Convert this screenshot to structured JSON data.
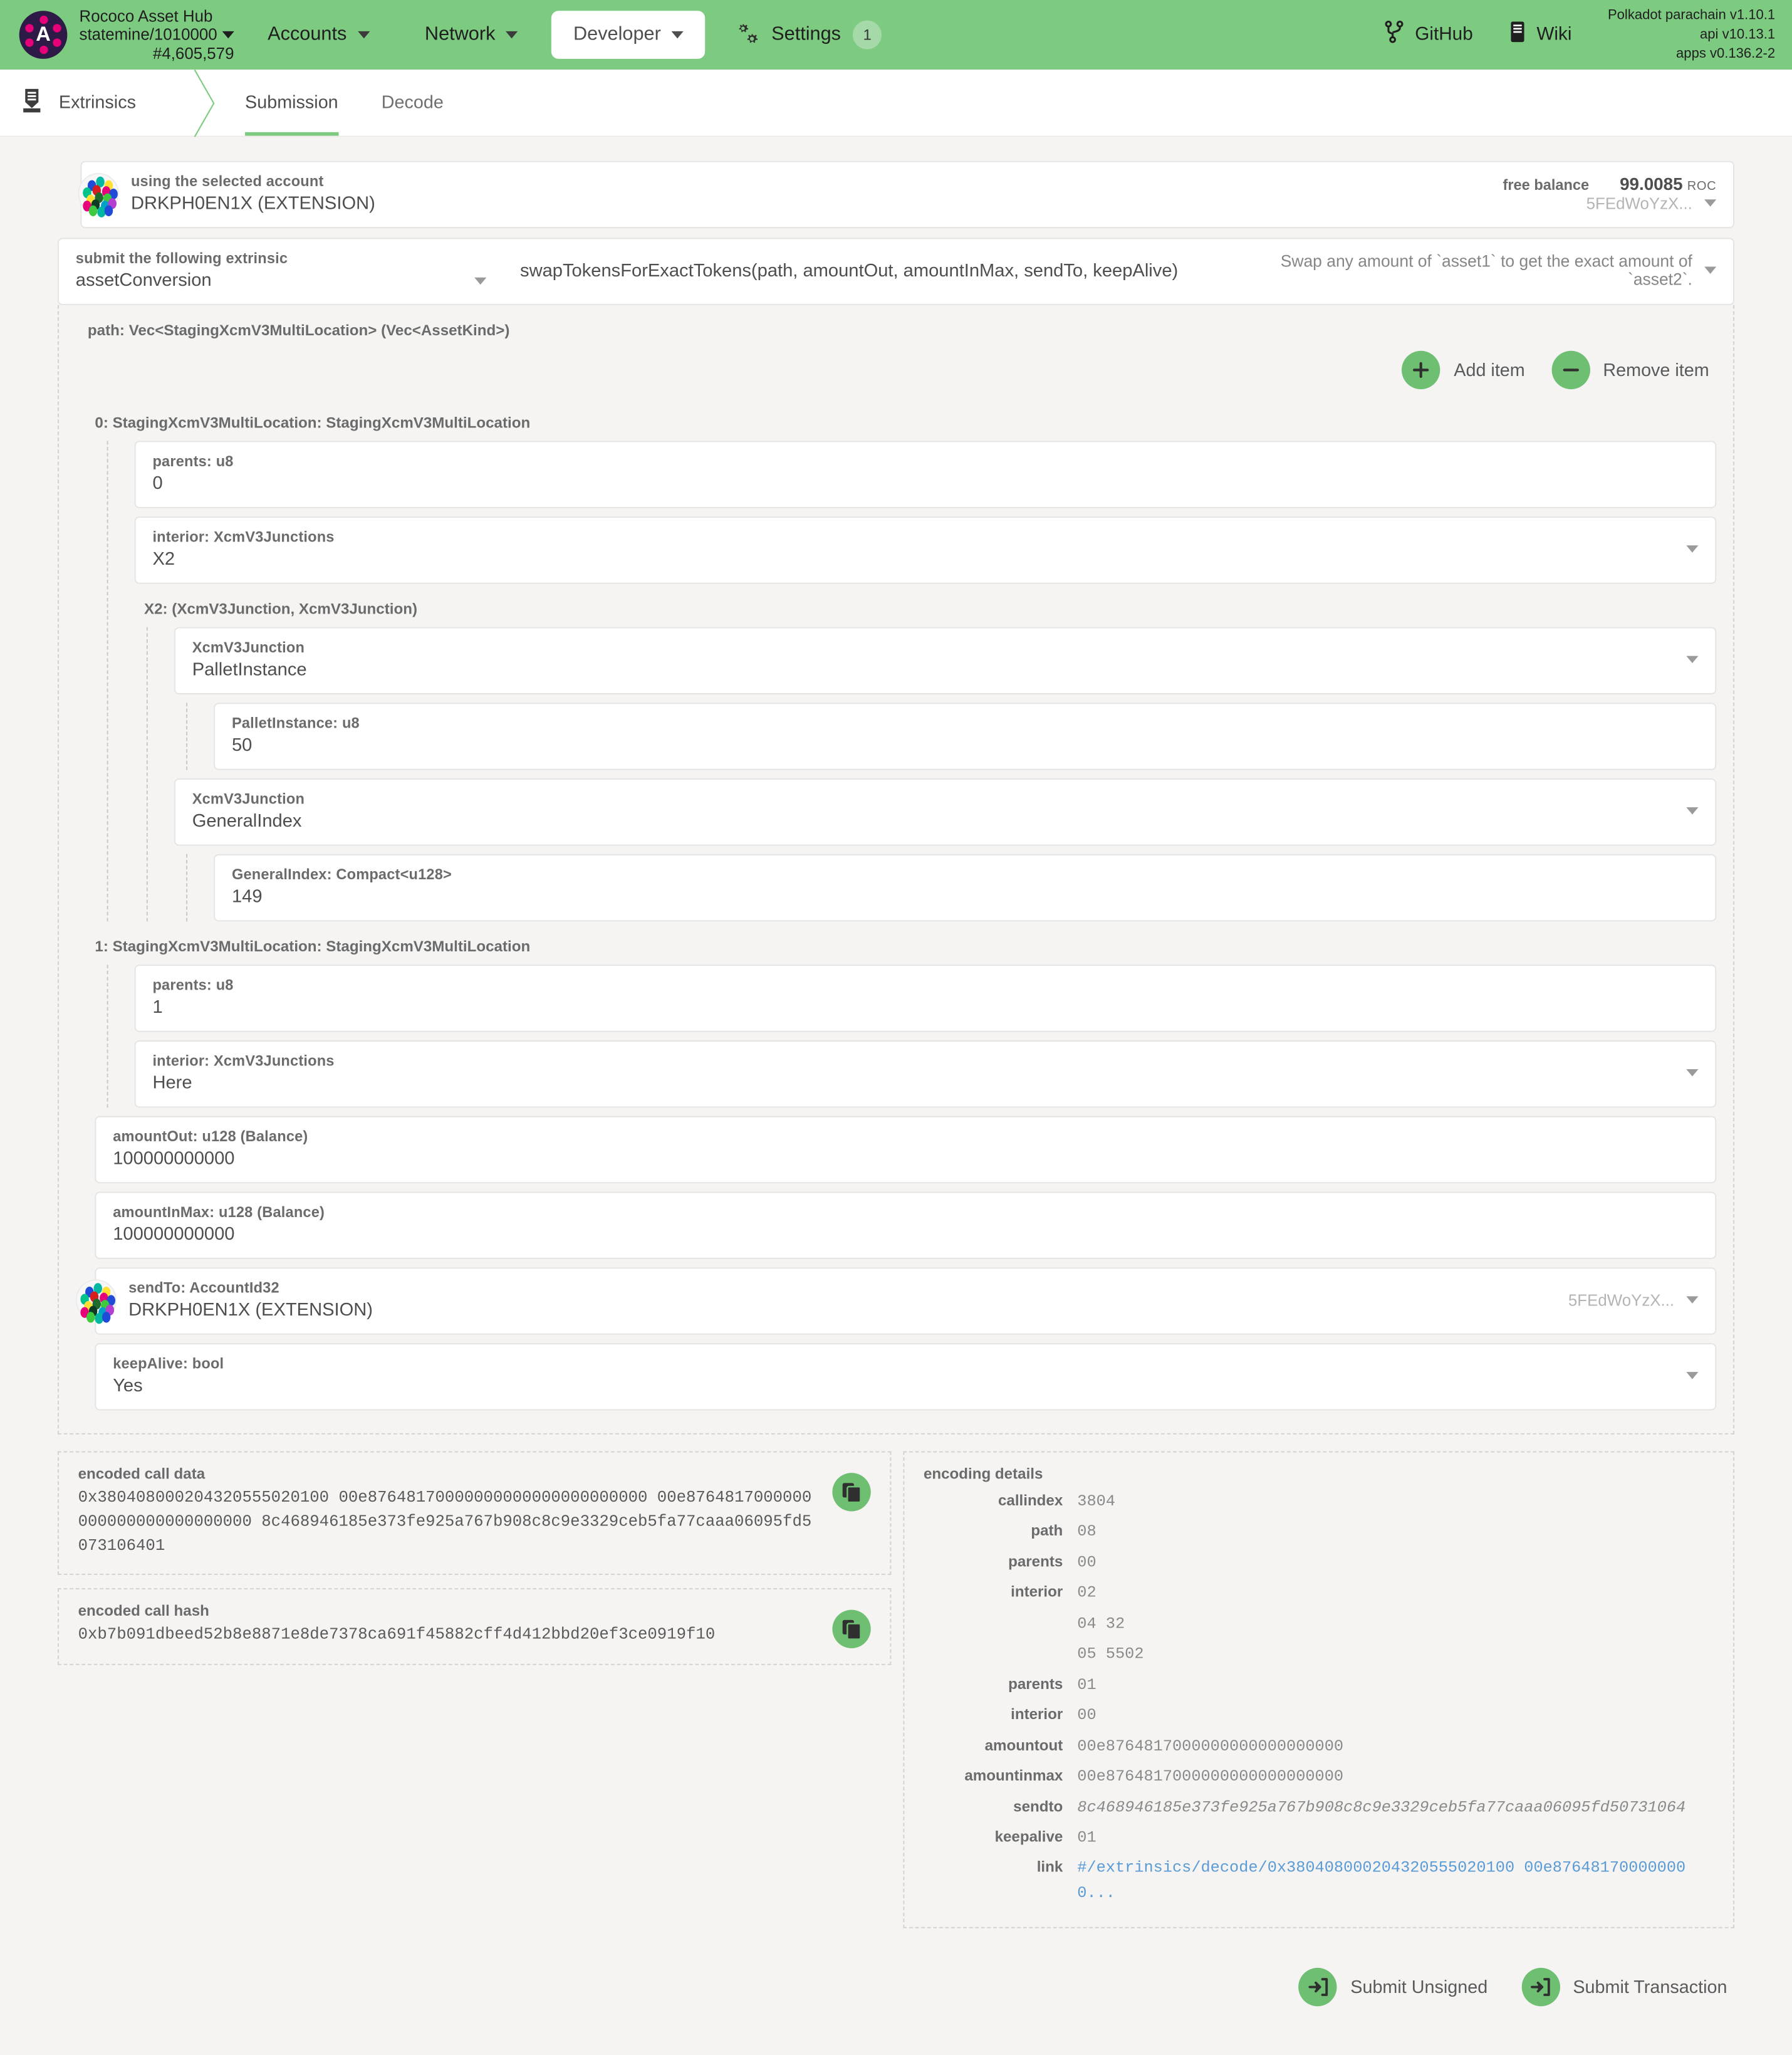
{
  "header": {
    "chain_name": "Rococo Asset Hub",
    "chain_spec": "statemine/1010000",
    "block_number": "#4,605,579",
    "logo_letter": "A",
    "nav": [
      {
        "label": "Accounts",
        "active": false
      },
      {
        "label": "Network",
        "active": false
      },
      {
        "label": "Developer",
        "active": true
      },
      {
        "label": "Settings",
        "active": false,
        "badge": "1"
      }
    ],
    "links": [
      {
        "label": "GitHub",
        "icon": "github-icon"
      },
      {
        "label": "Wiki",
        "icon": "book-icon"
      }
    ],
    "versions": [
      "Polkadot parachain v1.10.1",
      "api v10.13.1",
      "apps v0.136.2-2"
    ],
    "accent": "#7dca81"
  },
  "tabbar": {
    "section": "Extrinsics",
    "section_icon": "extrinsics-icon",
    "tabs": [
      {
        "label": "Submission",
        "active": true
      },
      {
        "label": "Decode",
        "active": false
      }
    ]
  },
  "account": {
    "label": "using the selected account",
    "value": "DRKPH0EN1X (EXTENSION)",
    "balance_label": "free balance",
    "balance_amount": "99.0085",
    "balance_unit": "ROC",
    "address_short": "5FEdWoYzX..."
  },
  "extrinsic": {
    "label": "submit the following extrinsic",
    "pallet": "assetConversion",
    "method": "swapTokensForExactTokens(path, amountOut, amountInMax, sendTo, keepAlive)",
    "doc": "Swap any amount of `asset1` to get the exact amount of `asset2`."
  },
  "params": {
    "path_label": "path: Vec<StagingXcmV3MultiLocation> (Vec<AssetKind>)",
    "add_item": "Add item",
    "remove_item": "Remove item",
    "items": [
      {
        "header": "0: StagingXcmV3MultiLocation: StagingXcmV3MultiLocation",
        "parents_label": "parents: u8",
        "parents_value": "0",
        "interior_label": "interior: XcmV3Junctions",
        "interior_value": "X2",
        "junctions_header": "X2: (XcmV3Junction, XcmV3Junction)",
        "junctions": [
          {
            "label": "XcmV3Junction",
            "value": "PalletInstance",
            "inner_label": "PalletInstance: u8",
            "inner_value": "50"
          },
          {
            "label": "XcmV3Junction",
            "value": "GeneralIndex",
            "inner_label": "GeneralIndex: Compact<u128>",
            "inner_value": "149"
          }
        ]
      },
      {
        "header": "1: StagingXcmV3MultiLocation: StagingXcmV3MultiLocation",
        "parents_label": "parents: u8",
        "parents_value": "1",
        "interior_label": "interior: XcmV3Junctions",
        "interior_value": "Here"
      }
    ],
    "amount_out_label": "amountOut: u128 (Balance)",
    "amount_out_value": "100000000000",
    "amount_in_max_label": "amountInMax: u128 (Balance)",
    "amount_in_max_value": "100000000000",
    "send_to_label": "sendTo: AccountId32",
    "send_to_value": "DRKPH0EN1X (EXTENSION)",
    "send_to_address": "5FEdWoYzX...",
    "keep_alive_label": "keepAlive: bool",
    "keep_alive_value": "Yes"
  },
  "encoded": {
    "call_data_label": "encoded call data",
    "call_data_value": "0x380408000204320555020100 00e87648170000000000000000000000 00e8764817000000000000000000000000 8c468946185e373fe925a767b908c8c9e3329ceb5fa77caaa06095fd5073106401",
    "call_hash_label": "encoded call hash",
    "call_hash_value": "0xb7b091dbeed52b8e8871e8de7378ca691f45882cff4d412bbd20ef3ce0919f10"
  },
  "encoding_details": {
    "title": "encoding details",
    "rows": [
      {
        "key": "callindex",
        "value": "3804"
      },
      {
        "key": "path",
        "value": "08"
      },
      {
        "key": "parents",
        "value": "00"
      },
      {
        "key": "interior",
        "value": "02"
      },
      {
        "key": "",
        "value": "04 32"
      },
      {
        "key": "",
        "value": "05 5502"
      },
      {
        "key": "parents",
        "value": "01"
      },
      {
        "key": "interior",
        "value": "00"
      },
      {
        "key": "amountout",
        "value": "00e8764817000000000000000000"
      },
      {
        "key": "amountinmax",
        "value": "00e8764817000000000000000000"
      },
      {
        "key": "sendto",
        "value": "8c468946185e373fe925a767b908c8c9e3329ceb5fa77caaa06095fd50731064"
      },
      {
        "key": "keepalive",
        "value": "01"
      },
      {
        "key": "link",
        "value": "#/extrinsics/decode/0x380408000204320555020100 00e876481700000000...",
        "is_link": true
      }
    ]
  },
  "footer": {
    "submit_unsigned": "Submit Unsigned",
    "submit_transaction": "Submit Transaction"
  }
}
